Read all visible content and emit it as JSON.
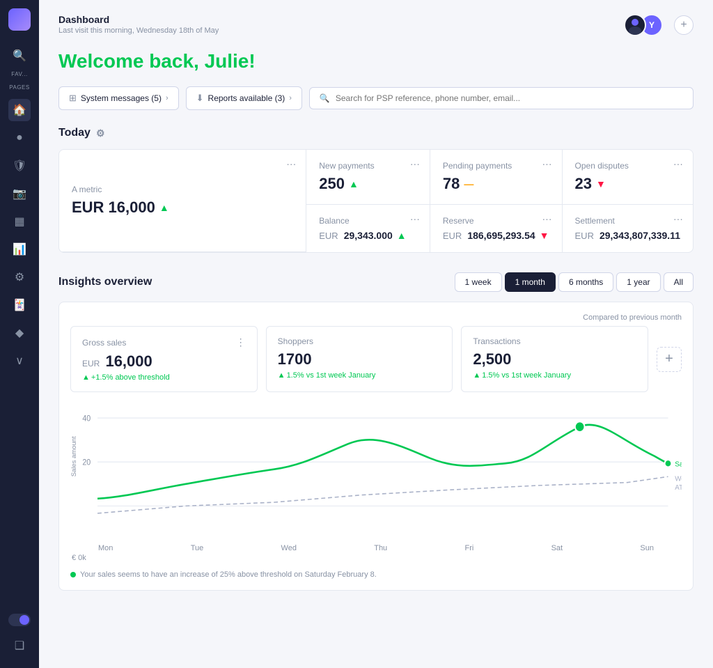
{
  "sidebar": {
    "logo_label": "Logo",
    "search_icon": "🔍",
    "fav_label": "FAV...",
    "pages_label": "PAGES",
    "icons": [
      "🏠",
      "⚫",
      "🛡",
      "📷",
      "▦",
      "📊",
      "⚙",
      "🃏",
      "◆"
    ],
    "active_index": 1,
    "chevron_down": "›",
    "theme_icon": "☾",
    "bottom_icon": "❑"
  },
  "header": {
    "title": "Dashboard",
    "subtitle": "Last visit this morning, Wednesday 18th of May",
    "avatar1_initials": "",
    "avatar2_initials": "Y",
    "plus_label": "+"
  },
  "welcome": {
    "text": "Welcome back, Julie!"
  },
  "actions": {
    "system_messages": "System messages (5)",
    "system_chevron": "›",
    "reports_available": "Reports available (3)",
    "reports_chevron": "›",
    "search_placeholder": "Search for PSP reference, phone number, email..."
  },
  "today": {
    "title": "Today",
    "gear_icon": "⚙",
    "big_metric": {
      "label": "A metric",
      "value": "EUR 16,000",
      "trend": "up"
    },
    "cards": [
      {
        "label": "New payments",
        "value": "250",
        "trend": "up"
      },
      {
        "label": "Pending payments",
        "value": "78",
        "trend": "neutral"
      },
      {
        "label": "Open disputes",
        "value": "23",
        "trend": "down"
      },
      {
        "label": "Balance",
        "prefix": "EUR",
        "value": "29,343.000",
        "trend": "up"
      },
      {
        "label": "Reserve",
        "prefix": "EUR",
        "value": "186,695,293.54",
        "trend": "down"
      },
      {
        "label": "Settlement",
        "prefix": "EUR",
        "value": "29,343,807,339.11",
        "trend": "none"
      }
    ]
  },
  "insights": {
    "title": "Insights overview",
    "compared_label": "Compared to previous month",
    "time_filters": [
      "1 week",
      "1 month",
      "6 months",
      "1 year",
      "All"
    ],
    "active_filter": "1 month",
    "cards": [
      {
        "label": "Gross sales",
        "prefix": "EUR",
        "value": "16,000",
        "change": "+1.5% above threshold"
      },
      {
        "label": "Shoppers",
        "prefix": "",
        "value": "1700",
        "change": "1.5% vs 1st week January"
      },
      {
        "label": "Transactions",
        "prefix": "",
        "value": "2,500",
        "change": "1.5% vs 1st week January"
      }
    ],
    "chart": {
      "y_labels": [
        "40",
        "20"
      ],
      "y_axis_label": "Sales amount",
      "x_labels": [
        "Mon",
        "Tue",
        "Wed",
        "Thu",
        "Fri",
        "Sat",
        "Sun"
      ],
      "y_zero_label": "€ 0k",
      "legend_sales": "Sales",
      "legend_weighted": "Weighted ATv",
      "footer_note": "● Your sales seems to have an increase of 25% above threshold on Saturday February 8."
    }
  }
}
